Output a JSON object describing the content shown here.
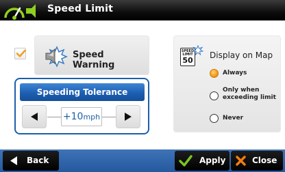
{
  "header": {
    "title": "Speed Limit",
    "logo_icon": "speedometer-logo"
  },
  "speed_warning": {
    "checked": true,
    "label": "Speed Warning",
    "icon": "speaker-alert-icon"
  },
  "tolerance": {
    "title": "Speeding Tolerance",
    "value": "+10",
    "unit": "mph",
    "decrease_icon": "triangle-left-icon",
    "increase_icon": "triangle-right-icon"
  },
  "display_on_map": {
    "title": "Display on Map",
    "sign_top": "SPEED LIMIT",
    "sign_value": "50",
    "options": [
      {
        "label": "Always",
        "selected": true
      },
      {
        "label_line1": "Only when",
        "label_line2": "exceeding limit",
        "selected": false
      },
      {
        "label": "Never",
        "selected": false
      }
    ]
  },
  "footer": {
    "back_label": "Back",
    "apply_label": "Apply",
    "close_label": "Close"
  },
  "colors": {
    "accent_blue": "#1d5fb2",
    "bar_blue": "#2f66ab",
    "radio_on": "#f39a12",
    "check_orange": "#f0a020",
    "apply_green": "#7ac221",
    "close_orange": "#f07d10"
  }
}
